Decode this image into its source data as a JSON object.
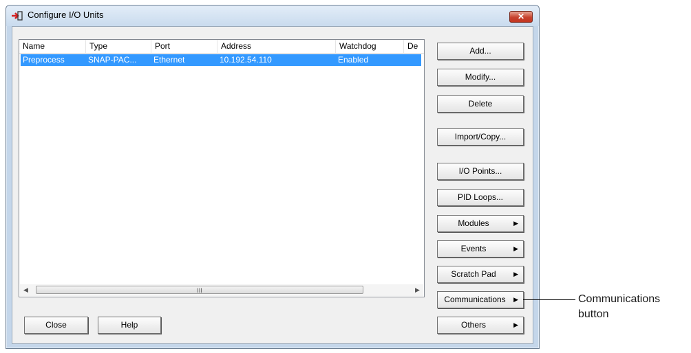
{
  "window": {
    "title": "Configure I/O Units",
    "close_glyph": "✕",
    "icon": "configure-io-icon"
  },
  "list": {
    "columns": [
      "Name",
      "Type",
      "Port",
      "Address",
      "Watchdog",
      "De"
    ],
    "rows": [
      {
        "name": "Preprocess",
        "type": "SNAP-PAC...",
        "port": "Ethernet",
        "address": "10.192.54.110",
        "watchdog": "Enabled",
        "extra": ""
      }
    ],
    "scroll_left": "◀",
    "scroll_right": "▶",
    "scroll_grip": "III"
  },
  "buttons": {
    "add": "Add...",
    "modify": "Modify...",
    "delete": "Delete",
    "import_copy": "Import/Copy...",
    "io_points": "I/O Points...",
    "pid_loops": "PID Loops...",
    "modules": "Modules",
    "events": "Events",
    "scratch_pad": "Scratch Pad",
    "communications": "Communications",
    "others": "Others",
    "close": "Close",
    "help": "Help",
    "submenu_arrow": "▶"
  },
  "annotation": {
    "line1": "Communications",
    "line2": "button"
  },
  "colors": {
    "selection": "#3399ff",
    "close_button": "#c7432e",
    "frame": "#c4d6ea"
  }
}
